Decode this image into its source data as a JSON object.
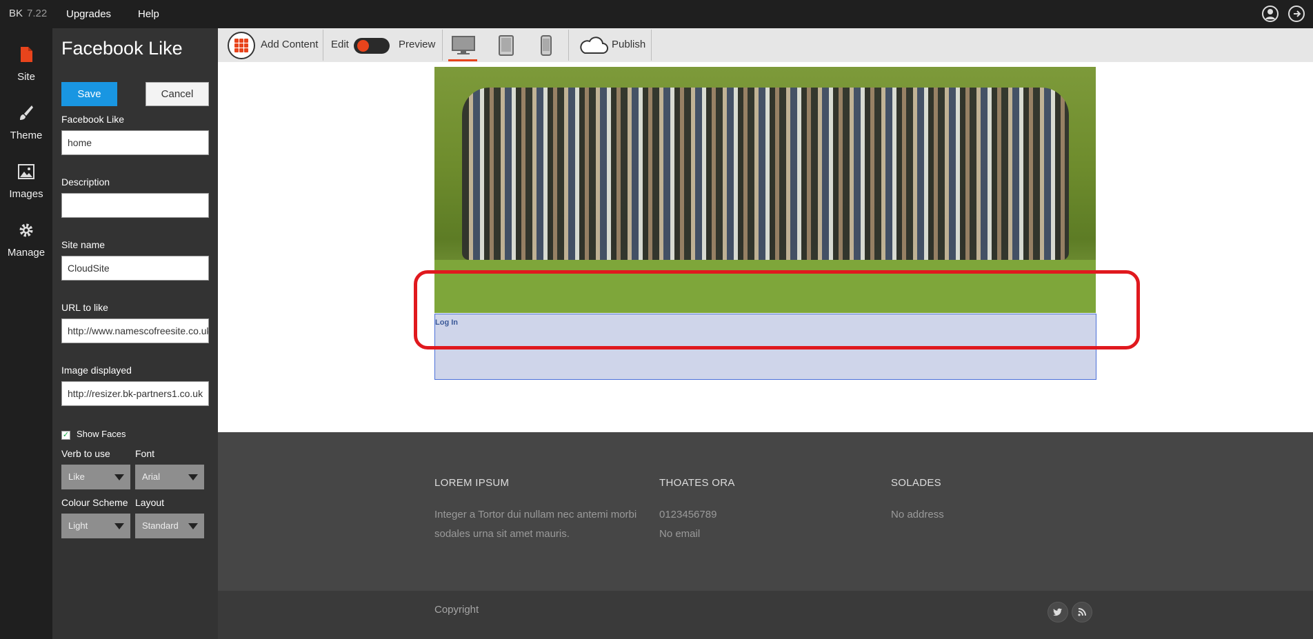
{
  "topbar": {
    "brand": "BK",
    "version": "7.22",
    "menu": [
      "Upgrades",
      "Help"
    ]
  },
  "rail": [
    {
      "label": "Site"
    },
    {
      "label": "Theme"
    },
    {
      "label": "Images"
    },
    {
      "label": "Manage"
    }
  ],
  "panel": {
    "title": "Facebook Like",
    "save_label": "Save",
    "cancel_label": "Cancel",
    "fields": [
      {
        "label": "Facebook Like",
        "value": "home"
      },
      {
        "label": "Description",
        "value": ""
      },
      {
        "label": "Site name",
        "value": "CloudSite"
      },
      {
        "label": "URL to like",
        "value": "http://www.namescofreesite.co.uk"
      },
      {
        "label": "Image displayed",
        "value": "http://resizer.bk-partners1.co.uk"
      }
    ],
    "show_faces_label": "Show Faces",
    "show_faces_checked": "✓",
    "verb_label": "Verb to use",
    "verb_value": "Like",
    "font_label": "Font",
    "font_value": "Arial",
    "colour_label": "Colour Scheme",
    "colour_value": "Light",
    "layout_label": "Layout",
    "layout_value": "Standard"
  },
  "toolbar": {
    "add_content": "Add Content",
    "edit": "Edit",
    "preview": "Preview",
    "publish": "Publish"
  },
  "canvas": {
    "fb_login": "Log In"
  },
  "footer": {
    "col1_title": "LOREM IPSUM",
    "col1_text_1": "Integer a Tortor dui nullam nec antemi morbi",
    "col1_text_2": "sodales urna sit amet mauris.",
    "col2_title": "THOATES ORA",
    "col2_phone": "0123456789",
    "col2_email": "No email",
    "col3_title": "SOLADES",
    "col3_address": "No address",
    "copyright": "Copyright"
  },
  "colors": {
    "accent": "#e8441c",
    "save": "#1996e2",
    "highlight": "#e0191e"
  }
}
